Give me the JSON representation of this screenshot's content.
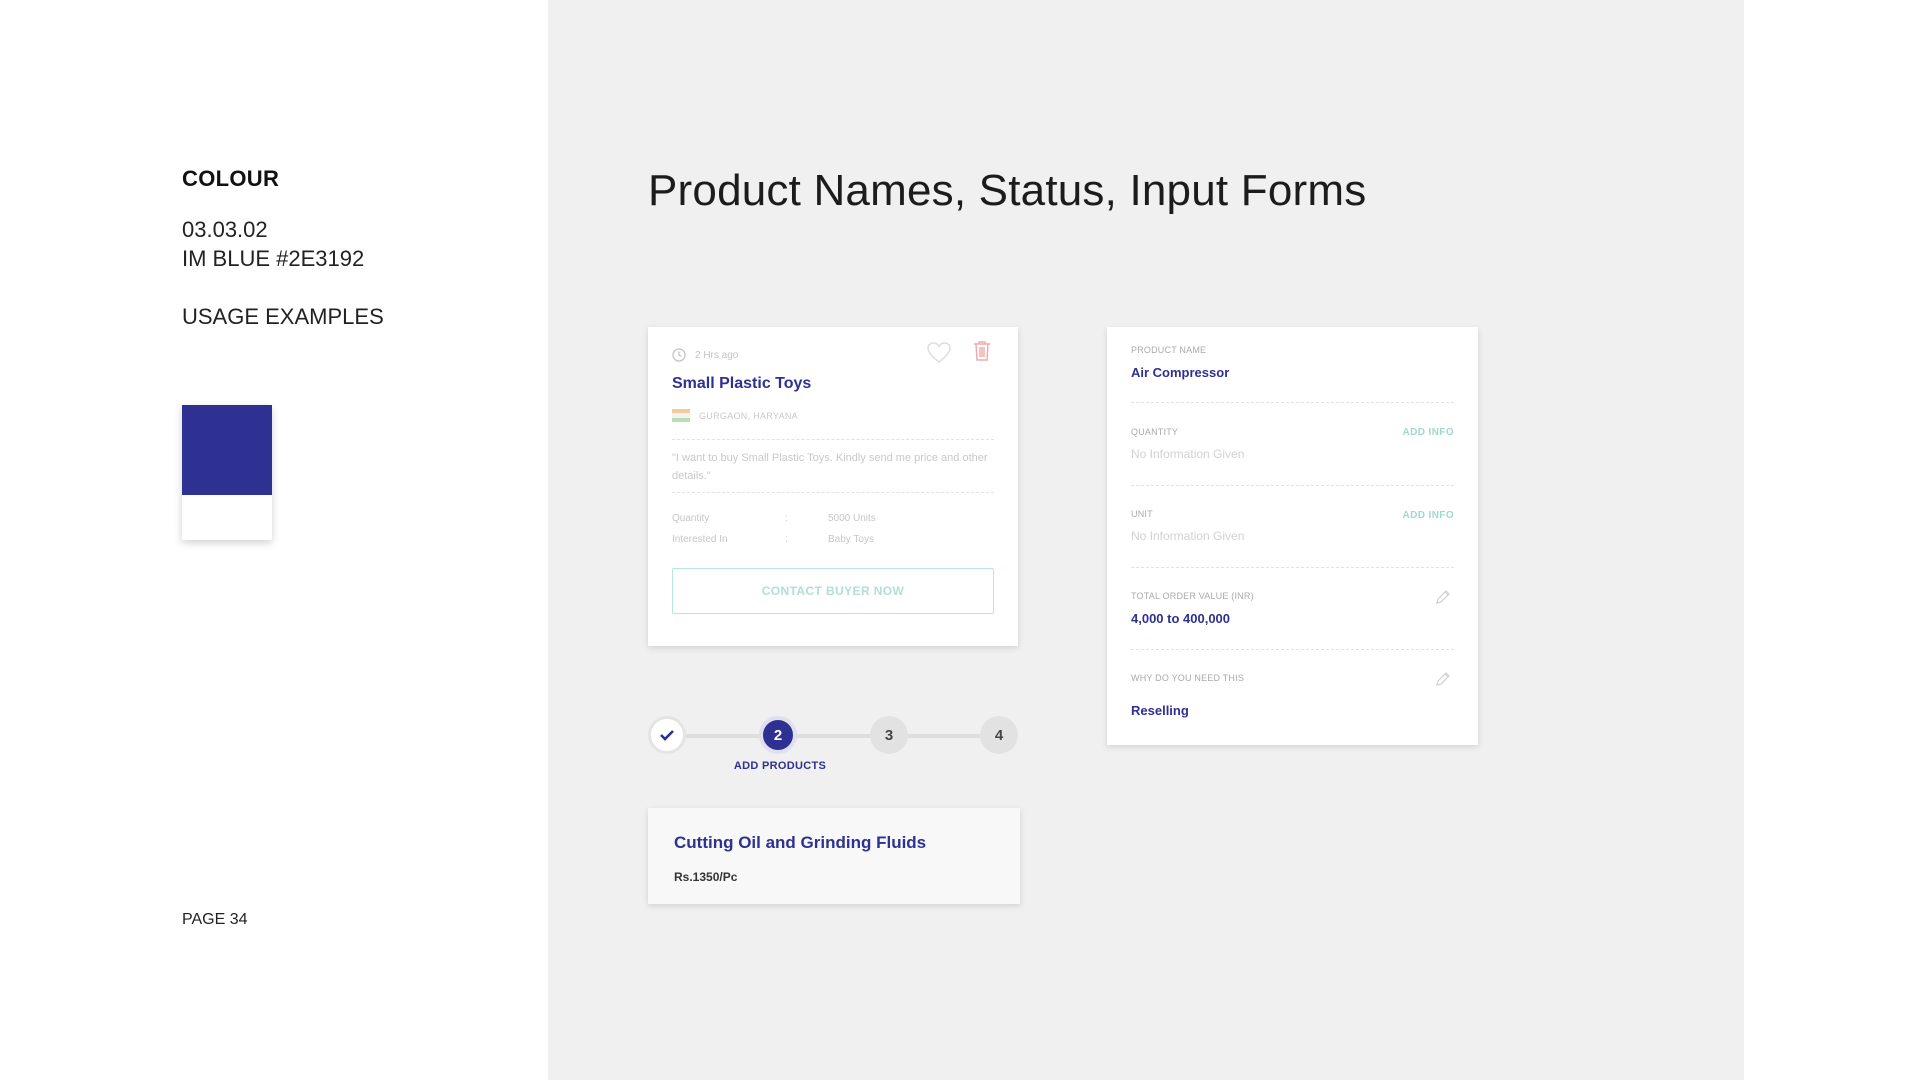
{
  "sidebar": {
    "section": "COLOUR",
    "code": "03.03.02",
    "color_name": "IM BLUE #2E3192",
    "usage": "USAGE EXAMPLES",
    "page": "PAGE 34"
  },
  "colors": {
    "brand": "#2E3192",
    "teal": "#9fd9cc",
    "delete": "#f1a7ab"
  },
  "main": {
    "heading": "Product Names, Status, Input Forms"
  },
  "lead_card": {
    "time": "2 Hrs ago",
    "title": "Small Plastic Toys",
    "location": "GURGAON, HARYANA",
    "quote": "\"I want to buy Small Plastic Toys. Kindly send me price and other details.\"",
    "specs": [
      {
        "label": "Quantity",
        "sep": ":",
        "value": "5000 Units"
      },
      {
        "label": "Interested In",
        "sep": ":",
        "value": "Baby Toys"
      }
    ],
    "cta": "CONTACT BUYER NOW",
    "icons": [
      "clock-icon",
      "heart-icon",
      "trash-icon",
      "india-flag-icon"
    ]
  },
  "stepper": {
    "steps": [
      "",
      "2",
      "3",
      "4"
    ],
    "active_label": "ADD PRODUCTS",
    "current_step": 2
  },
  "product_card": {
    "name": "Cutting Oil and Grinding Fluids",
    "price": "Rs.1350/Pc"
  },
  "form_card": {
    "product_label": "PRODUCT NAME",
    "product_value": "Air Compressor",
    "quantity_label": "QUANTITY",
    "quantity_placeholder": "No Information Given",
    "unit_label": "UNIT",
    "unit_placeholder": "No Information Given",
    "add_info": "ADD INFO",
    "order_label": "TOTAL ORDER VALUE (INR)",
    "order_value": "4,000 to 400,000",
    "why_label": "WHY DO YOU NEED THIS",
    "why_value": "Reselling"
  }
}
